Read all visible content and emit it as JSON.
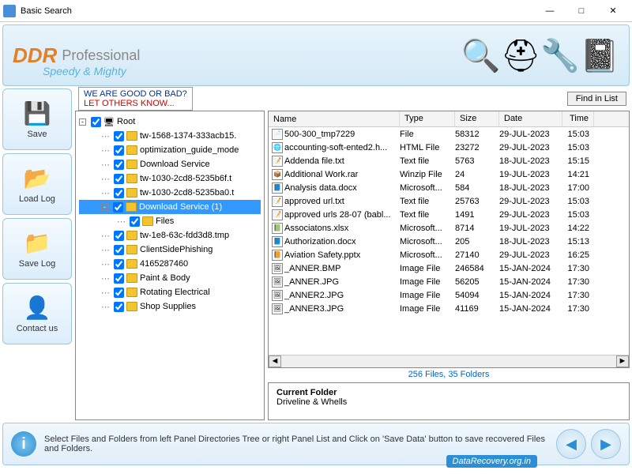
{
  "window": {
    "title": "Basic Search"
  },
  "banner": {
    "brand": "DDR",
    "sub": "Professional",
    "tagline": "Speedy & Mighty"
  },
  "feedback": {
    "l1": "WE ARE GOOD OR BAD?",
    "l2": "LET OTHERS KNOW..."
  },
  "find_btn": "Find in List",
  "sidebar": [
    {
      "label": "Save",
      "icon": "💾"
    },
    {
      "label": "Load Log",
      "icon": "📂"
    },
    {
      "label": "Save Log",
      "icon": "📁"
    },
    {
      "label": "Contact us",
      "icon": "👤"
    }
  ],
  "tree": {
    "root": "Root",
    "items": [
      {
        "d": 1,
        "name": "tw-1568-1374-333acb15."
      },
      {
        "d": 1,
        "name": "optimization_guide_mode"
      },
      {
        "d": 1,
        "name": "Download Service"
      },
      {
        "d": 1,
        "name": "tw-1030-2cd8-5235b6f.t"
      },
      {
        "d": 1,
        "name": "tw-1030-2cd8-5235ba0.t"
      },
      {
        "d": 1,
        "name": "Download Service (1)",
        "sel": true,
        "exp": "-"
      },
      {
        "d": 2,
        "name": "Files"
      },
      {
        "d": 1,
        "name": "tw-1e8-63c-fdd3d8.tmp"
      },
      {
        "d": 1,
        "name": "ClientSidePhishing"
      },
      {
        "d": 1,
        "name": "4165287460"
      },
      {
        "d": 1,
        "name": "Paint & Body"
      },
      {
        "d": 1,
        "name": "Rotating Electrical"
      },
      {
        "d": 1,
        "name": "Shop Supplies"
      }
    ]
  },
  "columns": {
    "name": "Name",
    "type": "Type",
    "size": "Size",
    "date": "Date",
    "time": "Time"
  },
  "files": [
    {
      "ic": "📄",
      "name": "500-300_tmp7229",
      "type": "File",
      "size": "58312",
      "date": "29-JUL-2023",
      "time": "15:03"
    },
    {
      "ic": "🌐",
      "name": "accounting-soft-ented2.h...",
      "type": "HTML File",
      "size": "23272",
      "date": "29-JUL-2023",
      "time": "15:03"
    },
    {
      "ic": "📝",
      "name": "Addenda file.txt",
      "type": "Text file",
      "size": "5763",
      "date": "18-JUL-2023",
      "time": "15:15"
    },
    {
      "ic": "📦",
      "name": "Additional Work.rar",
      "type": "Winzip File",
      "size": "24",
      "date": "19-JUL-2023",
      "time": "14:21"
    },
    {
      "ic": "📘",
      "name": "Analysis data.docx",
      "type": "Microsoft...",
      "size": "584",
      "date": "18-JUL-2023",
      "time": "17:00"
    },
    {
      "ic": "📝",
      "name": "approved url.txt",
      "type": "Text file",
      "size": "25763",
      "date": "29-JUL-2023",
      "time": "15:03"
    },
    {
      "ic": "📝",
      "name": "approved urls 28-07 (babl...",
      "type": "Text file",
      "size": "1491",
      "date": "29-JUL-2023",
      "time": "15:03"
    },
    {
      "ic": "📗",
      "name": "Associatons.xlsx",
      "type": "Microsoft...",
      "size": "8714",
      "date": "19-JUL-2023",
      "time": "14:22"
    },
    {
      "ic": "📘",
      "name": "Authorization.docx",
      "type": "Microsoft...",
      "size": "205",
      "date": "18-JUL-2023",
      "time": "15:13"
    },
    {
      "ic": "📙",
      "name": "Aviation Safety.pptx",
      "type": "Microsoft...",
      "size": "27140",
      "date": "29-JUL-2023",
      "time": "16:25"
    },
    {
      "ic": "🖼",
      "name": "_ANNER.BMP",
      "type": "Image File",
      "size": "246584",
      "date": "15-JAN-2024",
      "time": "17:30"
    },
    {
      "ic": "🖼",
      "name": "_ANNER.JPG",
      "type": "Image File",
      "size": "56205",
      "date": "15-JAN-2024",
      "time": "17:30"
    },
    {
      "ic": "🖼",
      "name": "_ANNER2.JPG",
      "type": "Image File",
      "size": "54094",
      "date": "15-JAN-2024",
      "time": "17:30"
    },
    {
      "ic": "🖼",
      "name": "_ANNER3.JPG",
      "type": "Image File",
      "size": "41169",
      "date": "15-JAN-2024",
      "time": "17:30"
    }
  ],
  "summary": "256 Files, 35 Folders",
  "current_folder": {
    "heading": "Current Folder",
    "path": "Driveline & Whells"
  },
  "footer": {
    "msg": "Select Files and Folders from left Panel Directories Tree or right Panel List and Click on 'Save Data' button to save recovered Files and Folders.",
    "link": "DataRecovery.org.in"
  }
}
